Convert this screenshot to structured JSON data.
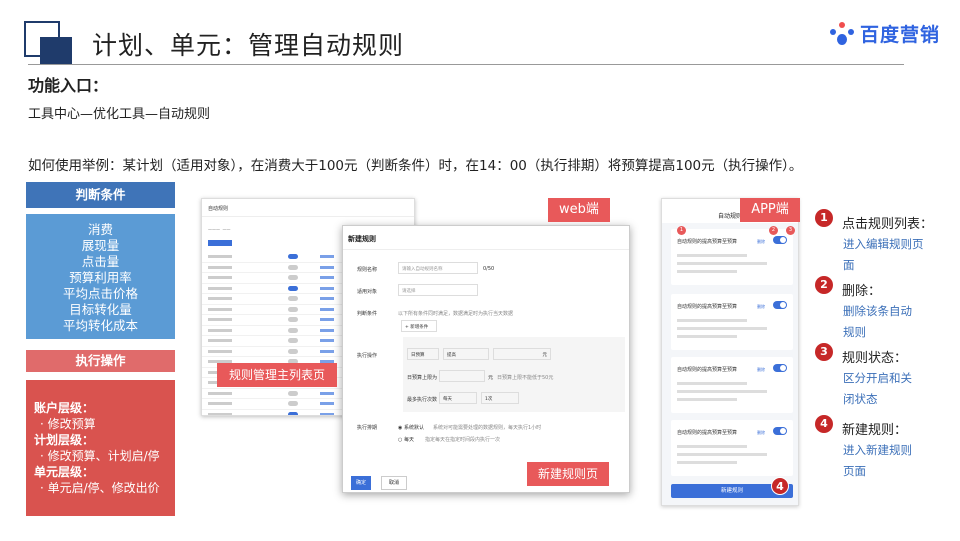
{
  "header": {
    "title": "计划、单元：管理自动规则",
    "logo_text": "百度营销"
  },
  "entry": {
    "heading": "功能入口：",
    "path": "工具中心—优化工具—自动规则"
  },
  "example": "如何使用举例：某计划（适用对象），在消费大于100元（判断条件）时，在14：00（执行排期）将预算提高100元（执行操作）。",
  "conditions": {
    "heading": "判断条件",
    "items": [
      "消费",
      "展现量",
      "点击量",
      "预算利用率",
      "平均点击价格",
      "目标转化量",
      "平均转化成本"
    ]
  },
  "actions": {
    "heading": "执行操作",
    "groups": [
      {
        "level": "账户层级：",
        "items": [
          "修改预算"
        ]
      },
      {
        "level": "计划层级：",
        "items": [
          "修改预算、计划启/停"
        ]
      },
      {
        "level": "单元层级：",
        "items": [
          "单元启/停、修改出价"
        ]
      }
    ]
  },
  "web": {
    "tag": "web端",
    "list_title": "自动规则",
    "list_tag": "规则管理主列表页",
    "dialog": {
      "title": "新建规则",
      "tag": "新建规则页",
      "fields": {
        "name_label": "规则名称",
        "name_placeholder": "请输入自动规则名称",
        "name_count": "0/50",
        "target_label": "适用对象",
        "target_placeholder": "请选择",
        "cond_label": "判断条件",
        "cond_hint": "以下所有条件同时满足，数据满足时为执行当天数据",
        "cond_add": "+ 新增条件",
        "op_label": "执行操作",
        "op_budget": "日预算",
        "op_raise": "提高",
        "op_unit": "元",
        "op_cap_label": "日预算上限为",
        "op_cap_unit": "元",
        "op_cap_hint": "日预算上限不能低于50元",
        "op_times_label": "最多执行次数",
        "op_times_freq": "每天",
        "op_times_val": "1次",
        "sched_label": "执行排期",
        "sched_opt1": "系统默认",
        "sched_opt1_desc": "系统对可能需要处理的数据规则，每天执行1小时",
        "sched_opt2": "每天",
        "sched_opt2_desc": "指定每天在指定时间段内执行一次",
        "ok": "确定",
        "cancel": "取消"
      }
    }
  },
  "app": {
    "tag": "APP端",
    "title": "自动规则",
    "card_title": "自动规则的提高预算至预算",
    "card_status": "删除",
    "new_button": "新建规则",
    "badges": [
      "1",
      "2",
      "3",
      "4"
    ]
  },
  "notes": [
    {
      "num": "1",
      "title": "点击规则列表：",
      "desc": [
        "进入编辑规则页",
        "面"
      ]
    },
    {
      "num": "2",
      "title": "删除：",
      "desc": [
        "删除该条自动",
        "规则"
      ]
    },
    {
      "num": "3",
      "title": "规则状态：",
      "desc": [
        "区分开启和关",
        "闭状态"
      ]
    },
    {
      "num": "4",
      "title": "新建规则：",
      "desc": [
        "进入新建规则",
        "页面"
      ]
    }
  ]
}
